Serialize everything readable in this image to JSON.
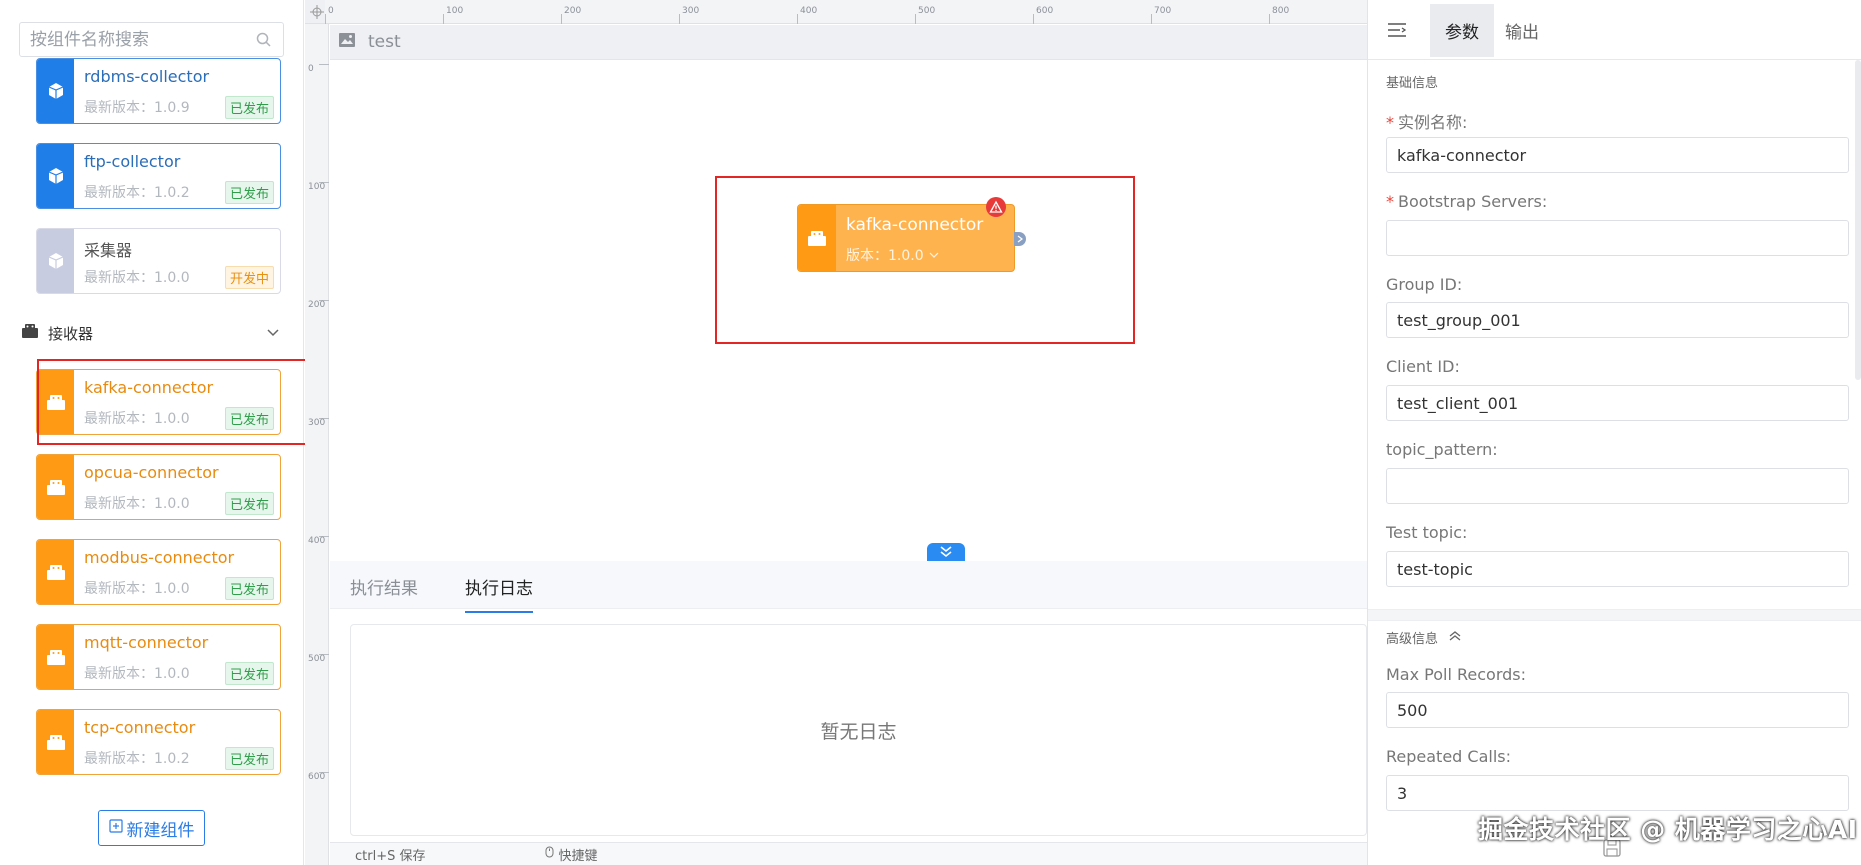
{
  "search": {
    "placeholder": "按组件名称搜索"
  },
  "components": [
    {
      "name": "rdbms-collector",
      "version": "最新版本：1.0.9",
      "status": "已发布"
    },
    {
      "name": "ftp-collector",
      "version": "最新版本：1.0.2",
      "status": "已发布"
    },
    {
      "name": "采集器",
      "version": "最新版本：1.0.0",
      "status": "开发中"
    }
  ],
  "group": {
    "label": "接收器"
  },
  "receivers": [
    {
      "name": "kafka-connector",
      "version": "最新版本：1.0.0",
      "status": "已发布"
    },
    {
      "name": "opcua-connector",
      "version": "最新版本：1.0.0",
      "status": "已发布"
    },
    {
      "name": "modbus-connector",
      "version": "最新版本：1.0.0",
      "status": "已发布"
    },
    {
      "name": "mqtt-connector",
      "version": "最新版本：1.0.0",
      "status": "已发布"
    },
    {
      "name": "tcp-connector",
      "version": "最新版本：1.0.2",
      "status": "已发布"
    }
  ],
  "new_button": {
    "label": "新建组件"
  },
  "ruler": {
    "top": [
      "0",
      "100",
      "200",
      "300",
      "400",
      "500",
      "600",
      "700",
      "800"
    ],
    "left": [
      "0",
      "100",
      "200",
      "300",
      "400",
      "500",
      "600"
    ]
  },
  "canvas": {
    "title": "test",
    "node": {
      "name": "kafka-connector",
      "version": "版本：1.0.0"
    }
  },
  "bottom": {
    "tabs": [
      "执行结果",
      "执行日志"
    ],
    "active_tab": "执行日志",
    "empty_text": "暂无日志",
    "save_hint": "ctrl+S 保存",
    "shortcut_hint": "快捷键"
  },
  "right": {
    "tabs": [
      "参数",
      "输出"
    ],
    "active_tab": "参数",
    "basic_title": "基础信息",
    "fields": [
      {
        "label": "实例名称:",
        "required": true,
        "value": "kafka-connector"
      },
      {
        "label": "Bootstrap Servers:",
        "required": true,
        "value": ""
      },
      {
        "label": "Group ID:",
        "required": false,
        "value": "test_group_001"
      },
      {
        "label": "Client ID:",
        "required": false,
        "value": "test_client_001"
      },
      {
        "label": "topic_pattern:",
        "required": false,
        "value": ""
      },
      {
        "label": "Test topic:",
        "required": false,
        "value": "test-topic"
      }
    ],
    "advanced_title": "高级信息",
    "adv_fields": [
      {
        "label": "Max Poll Records:",
        "value": "500"
      },
      {
        "label": "Repeated Calls:",
        "value": "3"
      }
    ]
  },
  "watermark": "掘金技术社区 @ 机器学习之心AI",
  "colors": {
    "blue_accent": "#1f7ee8",
    "orange_accent": "#ff9a14",
    "highlight_red": "#e42525",
    "published_green": "#2f9e4a",
    "developing_orange": "#e89111"
  }
}
